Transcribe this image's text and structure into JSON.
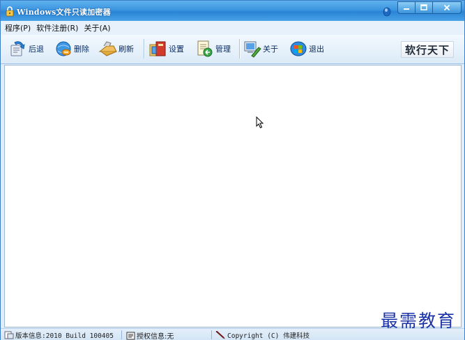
{
  "window": {
    "title": "Windows文件只读加密器"
  },
  "menu": {
    "items": [
      {
        "label": "程序(P)"
      },
      {
        "label": "软件注册(R)"
      },
      {
        "label": "关于(A)"
      }
    ]
  },
  "toolbar": {
    "back_label": "后退",
    "delete_label": "删除",
    "refresh_label": "刷新",
    "settings_label": "设置",
    "manage_label": "管理",
    "about_label": "关于",
    "exit_label": "退出",
    "brand_text": "软行天下"
  },
  "statusbar": {
    "version": "版本信息:2010 Build 100405",
    "license": "授权信息:无",
    "copyright": "Copyright (C) 伟建科技"
  },
  "watermark": "最需教育",
  "colors": {
    "titlebar": "#3c95df",
    "toolbar_text": "#0b2e66",
    "watermark": "#1c33a8"
  }
}
